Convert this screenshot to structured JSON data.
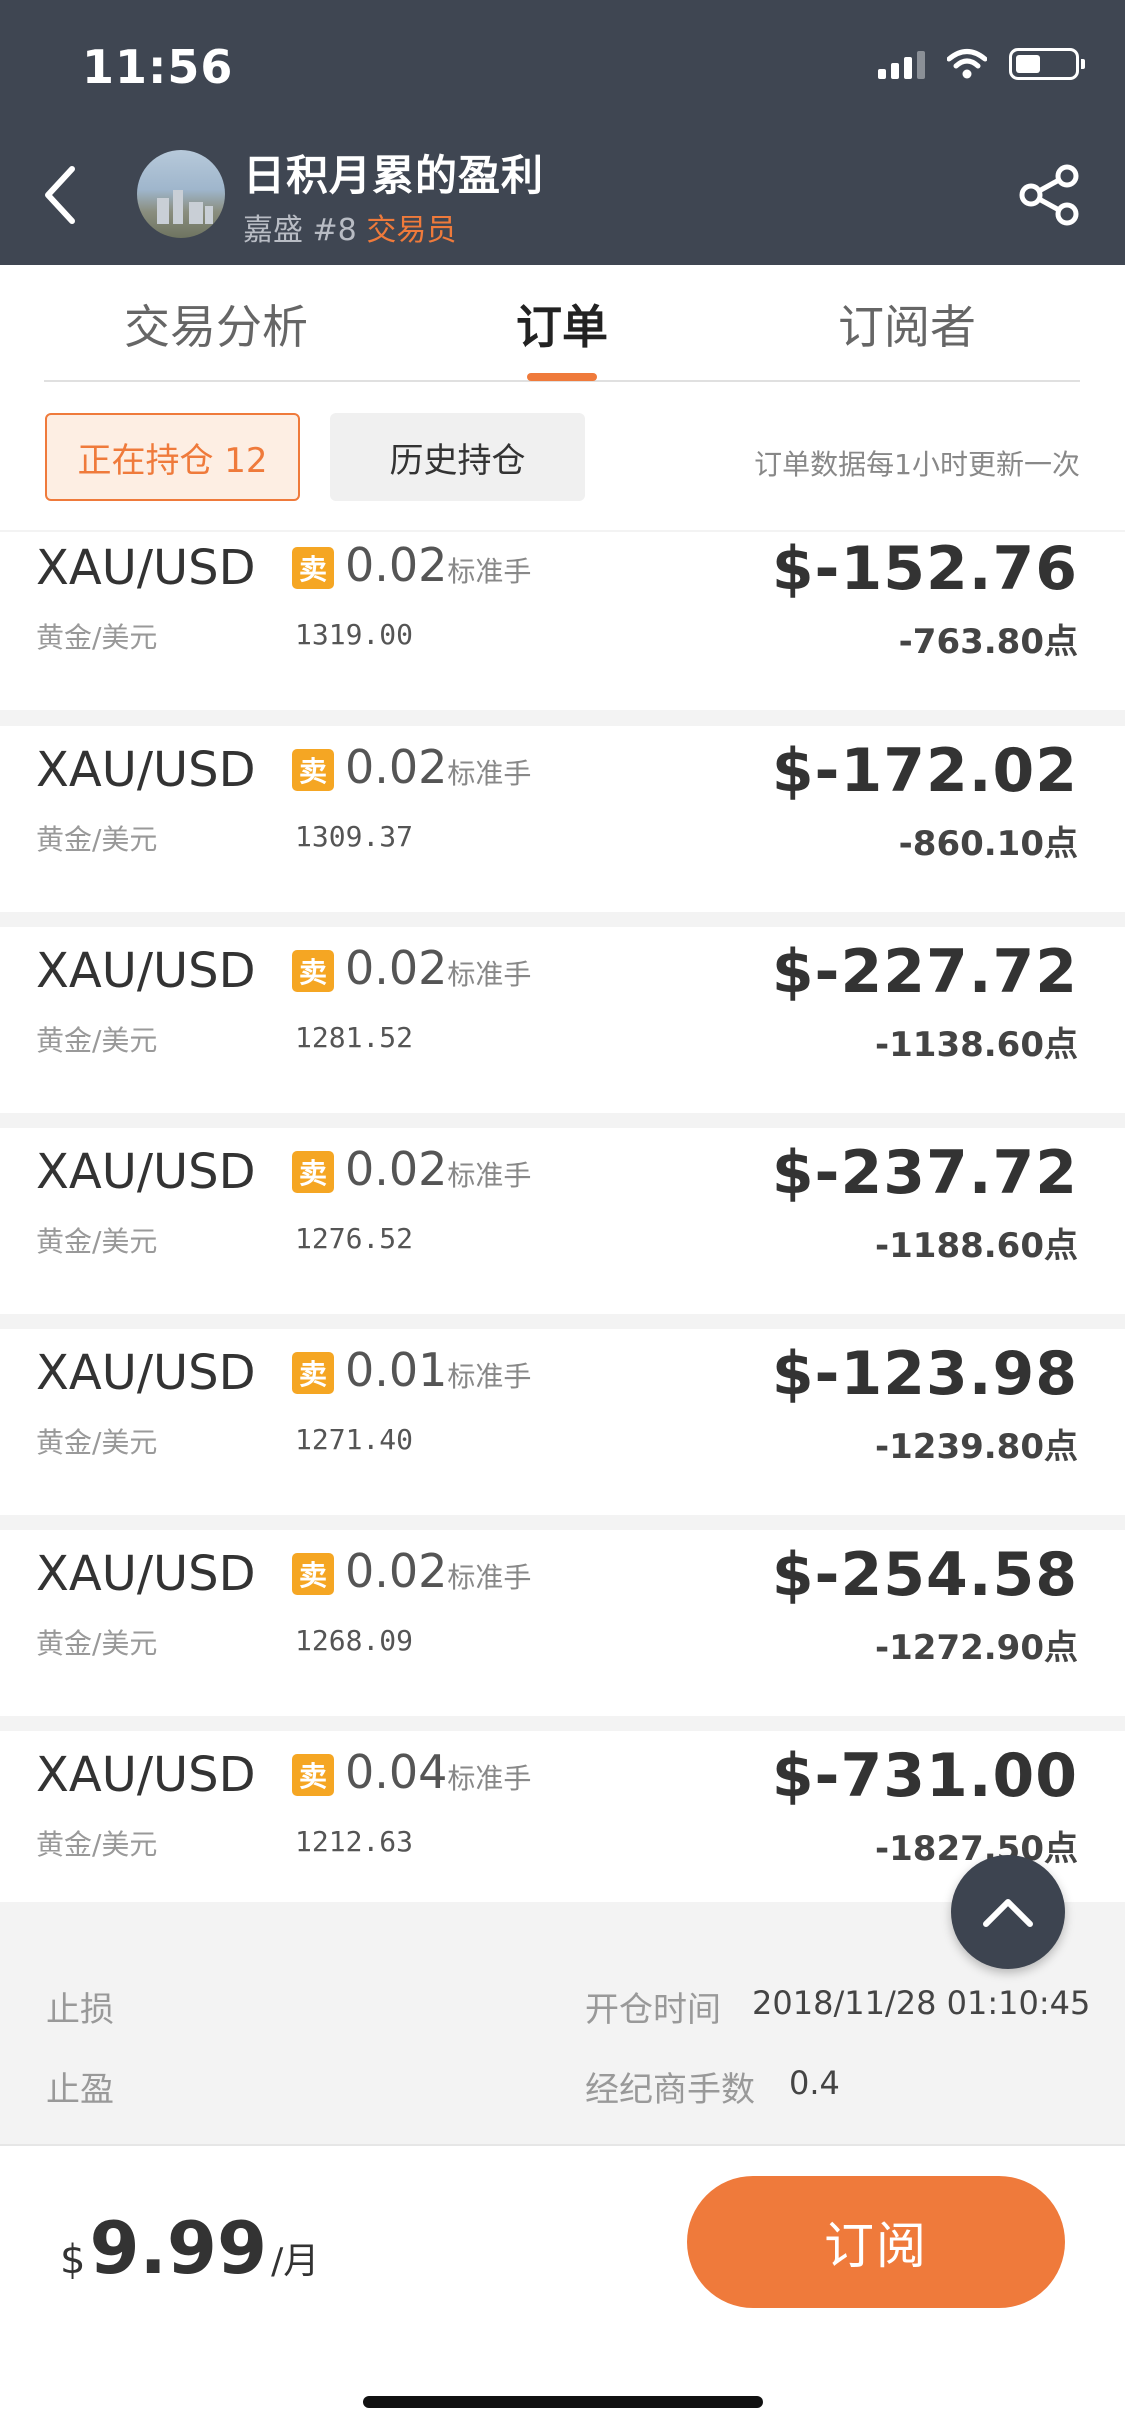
{
  "status_bar": {
    "time": "11:56"
  },
  "header": {
    "title": "日积月累的盈利",
    "broker": "嘉盛",
    "rank": "#8",
    "role": "交易员"
  },
  "tabs": [
    {
      "label": "交易分析",
      "active": false
    },
    {
      "label": "订单",
      "active": true
    },
    {
      "label": "订阅者",
      "active": false
    }
  ],
  "filters": {
    "open_positions": "正在持仓 12",
    "history_positions": "历史持仓",
    "update_note": "订单数据每1小时更新一次"
  },
  "orders": [
    {
      "symbol": "XAU/USD",
      "symbol_cn": "黄金/美元",
      "side": "卖",
      "lots": "0.02",
      "lot_unit": "标准手",
      "price": "1319.00",
      "pnl": "$-152.76",
      "points": "-763.80点"
    },
    {
      "symbol": "XAU/USD",
      "symbol_cn": "黄金/美元",
      "side": "卖",
      "lots": "0.02",
      "lot_unit": "标准手",
      "price": "1309.37",
      "pnl": "$-172.02",
      "points": "-860.10点"
    },
    {
      "symbol": "XAU/USD",
      "symbol_cn": "黄金/美元",
      "side": "卖",
      "lots": "0.02",
      "lot_unit": "标准手",
      "price": "1281.52",
      "pnl": "$-227.72",
      "points": "-1138.60点"
    },
    {
      "symbol": "XAU/USD",
      "symbol_cn": "黄金/美元",
      "side": "卖",
      "lots": "0.02",
      "lot_unit": "标准手",
      "price": "1276.52",
      "pnl": "$-237.72",
      "points": "-1188.60点"
    },
    {
      "symbol": "XAU/USD",
      "symbol_cn": "黄金/美元",
      "side": "卖",
      "lots": "0.01",
      "lot_unit": "标准手",
      "price": "1271.40",
      "pnl": "$-123.98",
      "points": "-1239.80点"
    },
    {
      "symbol": "XAU/USD",
      "symbol_cn": "黄金/美元",
      "side": "卖",
      "lots": "0.02",
      "lot_unit": "标准手",
      "price": "1268.09",
      "pnl": "$-254.58",
      "points": "-1272.90点"
    },
    {
      "symbol": "XAU/USD",
      "symbol_cn": "黄金/美元",
      "side": "卖",
      "lots": "0.04",
      "lot_unit": "标准手",
      "price": "1212.63",
      "pnl": "$-731.00",
      "points": "-1827.50点"
    }
  ],
  "details": {
    "stop_loss_label": "止损",
    "take_profit_label": "止盈",
    "open_time_label": "开仓时间",
    "open_time_value": "2018/11/28 01:10:45",
    "broker_lots_label": "经纪商手数",
    "broker_lots_value": "0.4"
  },
  "footer": {
    "currency": "$",
    "amount": "9.99",
    "period": "/月",
    "subscribe_label": "订阅"
  },
  "colors": {
    "accent": "#ef7a3b",
    "header_bg": "#3f4652",
    "sell_badge": "#f5a623"
  },
  "icons": [
    "back-icon",
    "share-icon",
    "arrow-up-icon",
    "wifi-icon",
    "signal-icon",
    "battery-icon"
  ]
}
